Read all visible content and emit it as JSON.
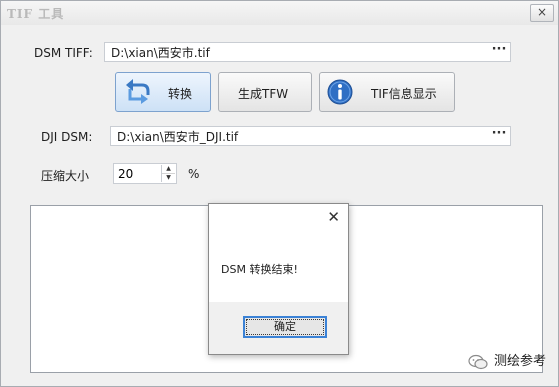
{
  "window": {
    "title": "TIF 工具",
    "close_glyph": "×"
  },
  "dsm_tiff": {
    "label": "DSM TIFF:",
    "value": "D:\\xian\\西安市.tif",
    "browse_glyph": "···"
  },
  "toolbar": {
    "convert_label": "转换",
    "convert_icon": "refresh-arrow-icon",
    "tfw_label": "生成TFW",
    "info_label": "TIF信息显示",
    "info_icon": "info-icon"
  },
  "dji_dsm": {
    "label": "DJI DSM:",
    "value": "D:\\xian\\西安市_DJI.tif",
    "browse_glyph": "···"
  },
  "compression": {
    "label": "压缩大小",
    "value": "20",
    "unit": "%"
  },
  "dialog": {
    "close_glyph": "✕",
    "message": "DSM 转换结束!",
    "ok_label": "确定"
  },
  "watermark": {
    "text": "测绘参考",
    "icon": "wechat-icon"
  },
  "colors": {
    "accent": "#3b82d6",
    "info_icon_blue": "#2f6fc4"
  }
}
